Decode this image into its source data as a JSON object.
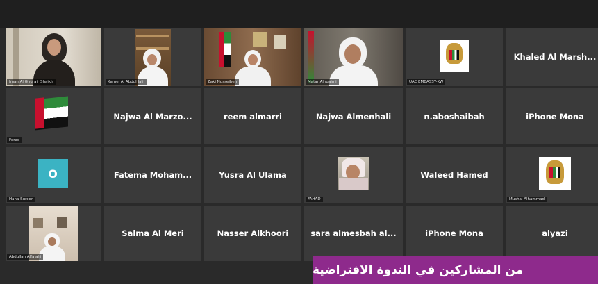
{
  "participants": {
    "r1": [
      {
        "label": "Iman Al Ghurair Shaikh"
      },
      {
        "label": "Kamel Al Abdul Jalil"
      },
      {
        "label": "Zaki Nusseibeh"
      },
      {
        "label": "Matar Alnuaimi"
      },
      {
        "label": "UAE EMBASSY-KW"
      },
      {
        "name": "Khaled Al Marsh..."
      }
    ],
    "r2": [
      {
        "label": "Feras"
      },
      {
        "name": "Najwa Al Marzo..."
      },
      {
        "name": "reem almarri"
      },
      {
        "name": "Najwa Almenhali"
      },
      {
        "name": "n.aboshaibah"
      },
      {
        "name": "iPhone Mona"
      }
    ],
    "r3": [
      {
        "label": "Hana Suroor",
        "avatar_letter": "O"
      },
      {
        "name": "Fatema Moham..."
      },
      {
        "name": "Yusra Al Ulama"
      },
      {
        "label": "FAHAD"
      },
      {
        "name": "Waleed Hamed"
      },
      {
        "label": "Mushal Alhammadi"
      }
    ],
    "r4": [
      {
        "label": "Abdullah Alfalahi"
      },
      {
        "name": "Salma Al Meri"
      },
      {
        "name": "Nasser Alkhoori"
      },
      {
        "name": "sara almesbah al..."
      },
      {
        "name": "iPhone Mona"
      },
      {
        "name": "alyazi"
      }
    ]
  },
  "caption": "من المشاركين في الندوة الافتراضية",
  "colors": {
    "caption_bg": "#8e2a8c",
    "active_border": "#f0d24a",
    "tile_bg": "#3a3a3a"
  }
}
